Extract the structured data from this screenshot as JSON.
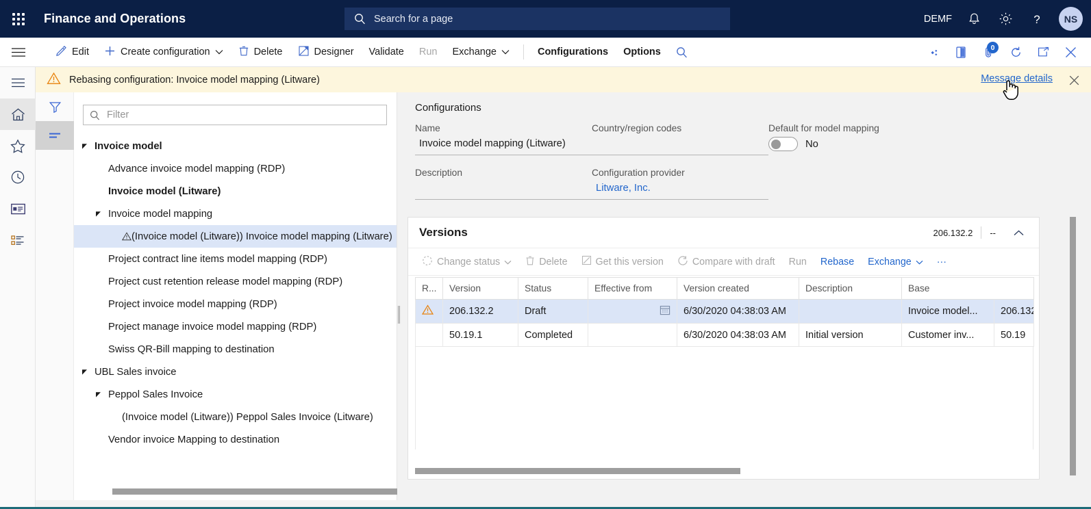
{
  "topbar": {
    "waffle_icon": "waffle-icon",
    "app_title": "Finance and Operations",
    "search_placeholder": "Search for a page",
    "search_value": "",
    "company": "DEMF",
    "notification_icon": "bell-icon",
    "settings_icon": "gear-icon",
    "help_icon": "help-icon",
    "user_initials": "NS"
  },
  "actionbar": {
    "hamburger_icon": "hamburger-icon",
    "items": [
      {
        "label": "Edit",
        "icon": "pencil-icon",
        "disabled": false,
        "bold": false,
        "caret": false
      },
      {
        "label": "Create configuration",
        "icon": "plus-icon",
        "disabled": false,
        "bold": false,
        "caret": true
      },
      {
        "label": "Delete",
        "icon": "trash-icon",
        "disabled": false,
        "bold": false,
        "caret": false
      },
      {
        "label": "Designer",
        "icon": "designer-icon",
        "disabled": false,
        "bold": false,
        "caret": false
      },
      {
        "label": "Validate",
        "icon": "",
        "disabled": false,
        "bold": false,
        "caret": false
      },
      {
        "label": "Run",
        "icon": "",
        "disabled": true,
        "bold": false,
        "caret": false
      },
      {
        "label": "Exchange",
        "icon": "",
        "disabled": false,
        "bold": false,
        "caret": true
      },
      {
        "label": "Configurations",
        "icon": "",
        "disabled": false,
        "bold": true,
        "caret": false
      },
      {
        "label": "Options",
        "icon": "",
        "disabled": false,
        "bold": true,
        "caret": false
      }
    ],
    "search_icon": "search-icon",
    "right_icons": [
      "share-icon",
      "open-in-office-icon",
      "attachments-icon",
      "refresh-icon",
      "popout-icon",
      "close-icon"
    ],
    "attachment_badge": "0"
  },
  "message_bar": {
    "warning_icon": "warning-triangle-icon",
    "text": "Rebasing configuration: Invoice model mapping (Litware)",
    "details_link": "Message details",
    "close_icon": "close-icon",
    "background": "#fdf6dd"
  },
  "left_rail": {
    "items": [
      {
        "name": "hamburger",
        "icon": "hamburger-icon",
        "active": false
      },
      {
        "name": "home",
        "icon": "home-icon",
        "active": true
      },
      {
        "name": "favorites",
        "icon": "star-icon",
        "active": false
      },
      {
        "name": "recent",
        "icon": "clock-icon",
        "active": false
      },
      {
        "name": "workspaces",
        "icon": "workspace-icon",
        "active": false
      },
      {
        "name": "modules",
        "icon": "list-icon",
        "active": false
      }
    ]
  },
  "tree_pane": {
    "tools": [
      {
        "name": "filter",
        "icon": "funnel-icon",
        "active": false
      },
      {
        "name": "list-view",
        "icon": "lines-icon",
        "active": true
      }
    ],
    "filter": {
      "placeholder": "Filter",
      "value": "",
      "icon": "search-icon"
    },
    "nodes": [
      {
        "label": "Invoice model",
        "indent": 0,
        "expander": true,
        "bold": true,
        "selected": false,
        "warn": false
      },
      {
        "label": "Advance invoice model mapping (RDP)",
        "indent": 1,
        "expander": false,
        "bold": false,
        "selected": false,
        "warn": false
      },
      {
        "label": "Invoice model (Litware)",
        "indent": 1,
        "expander": false,
        "bold": true,
        "selected": false,
        "warn": false
      },
      {
        "label": "Invoice model mapping",
        "indent": 1,
        "expander": true,
        "bold": false,
        "selected": false,
        "warn": false
      },
      {
        "label": "(Invoice model (Litware)) Invoice model mapping (Litware)",
        "indent": 2,
        "expander": false,
        "bold": false,
        "selected": true,
        "warn": true
      },
      {
        "label": "Project contract line items model mapping (RDP)",
        "indent": 1,
        "expander": false,
        "bold": false,
        "selected": false,
        "warn": false
      },
      {
        "label": "Project cust retention release model mapping (RDP)",
        "indent": 1,
        "expander": false,
        "bold": false,
        "selected": false,
        "warn": false
      },
      {
        "label": "Project invoice model mapping (RDP)",
        "indent": 1,
        "expander": false,
        "bold": false,
        "selected": false,
        "warn": false
      },
      {
        "label": "Project manage invoice model mapping (RDP)",
        "indent": 1,
        "expander": false,
        "bold": false,
        "selected": false,
        "warn": false
      },
      {
        "label": "Swiss QR-Bill mapping to destination",
        "indent": 1,
        "expander": false,
        "bold": false,
        "selected": false,
        "warn": false
      },
      {
        "label": "UBL Sales invoice",
        "indent": 0,
        "expander": true,
        "bold": false,
        "selected": false,
        "warn": false
      },
      {
        "label": "Peppol Sales Invoice",
        "indent": 1,
        "expander": true,
        "bold": false,
        "selected": false,
        "warn": false
      },
      {
        "label": "(Invoice model (Litware)) Peppol Sales Invoice (Litware)",
        "indent": 2,
        "expander": false,
        "bold": false,
        "selected": false,
        "warn": false
      },
      {
        "label": "Vendor invoice Mapping to destination",
        "indent": 1,
        "expander": false,
        "bold": false,
        "selected": false,
        "warn": false
      }
    ]
  },
  "form": {
    "section_title": "Configurations",
    "name_label": "Name",
    "name_value": "Invoice model mapping (Litware)",
    "country_label": "Country/region codes",
    "country_value": "",
    "default_label": "Default for model mapping",
    "default_value": "No",
    "description_label": "Description",
    "description_value": "",
    "provider_label": "Configuration provider",
    "provider_value": "Litware, Inc."
  },
  "versions": {
    "title": "Versions",
    "summary_version": "206.132.2",
    "summary_dash": "--",
    "collapse_icon": "chevron-up-icon",
    "tools": [
      {
        "label": "Change status",
        "icon": "status-icon",
        "disabled": true,
        "caret": true,
        "blue": false
      },
      {
        "label": "Delete",
        "icon": "trash-icon",
        "disabled": true,
        "caret": false,
        "blue": false
      },
      {
        "label": "Get this version",
        "icon": "get-version-icon",
        "disabled": true,
        "caret": false,
        "blue": false
      },
      {
        "label": "Compare with draft",
        "icon": "compare-icon",
        "disabled": true,
        "caret": false,
        "blue": false
      },
      {
        "label": "Run",
        "icon": "",
        "disabled": true,
        "caret": false,
        "blue": false
      },
      {
        "label": "Rebase",
        "icon": "",
        "disabled": false,
        "caret": false,
        "blue": true
      },
      {
        "label": "Exchange",
        "icon": "",
        "disabled": false,
        "caret": true,
        "blue": true
      },
      {
        "label": "···",
        "icon": "",
        "disabled": false,
        "caret": false,
        "blue": true
      }
    ],
    "columns": [
      "R...",
      "Version",
      "Status",
      "Effective from",
      "Version created",
      "Description",
      "Base",
      ""
    ],
    "rows": [
      {
        "selected": true,
        "warn": true,
        "version": "206.132.2",
        "status": "Draft",
        "effective_from": "",
        "effective_icon": "calendar-icon",
        "created": "6/30/2020 04:38:03 AM",
        "description": "",
        "base_name": "Invoice model...",
        "base_name_link": true,
        "base_version": "206.132",
        "base_version_link": true
      },
      {
        "selected": false,
        "warn": false,
        "version": "50.19.1",
        "status": "Completed",
        "effective_from": "",
        "effective_icon": "",
        "created": "6/30/2020 04:38:03 AM",
        "description": "Initial version",
        "base_name": "Customer inv...",
        "base_name_link": false,
        "base_version": "50.19",
        "base_version_link": false
      }
    ]
  },
  "colors": {
    "nav_bg": "#0b1f45",
    "nav_search_bg": "#1b3363",
    "accent_link": "#2266cc",
    "warning_bg": "#fdf6dd",
    "warning_icon": "#e8820c",
    "row_selected": "#dbe5f7",
    "page_bg": "#f2f2f2",
    "bottom_accent": "#1d6b78"
  }
}
